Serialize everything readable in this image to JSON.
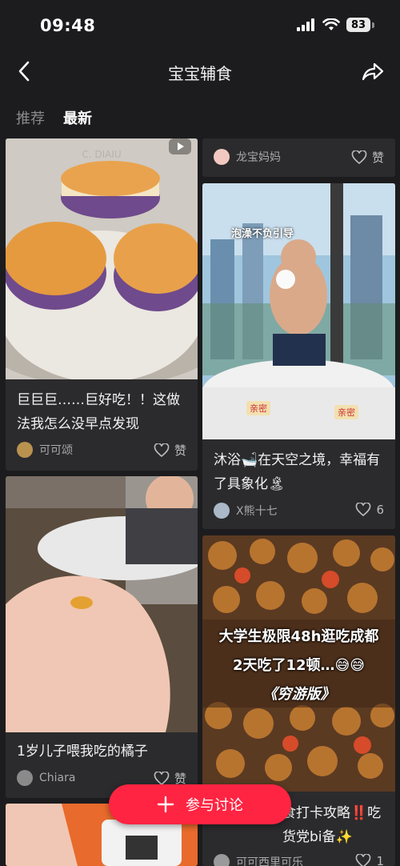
{
  "status_bar": {
    "time": "09:48",
    "battery": "83"
  },
  "nav": {
    "title": "宝宝辅食"
  },
  "tabs": [
    {
      "label": "推荐"
    },
    {
      "label": "最新"
    }
  ],
  "posts": [
    {
      "title": "巨巨巨……巨好吃！！这做法我怎么没早点发现",
      "author": "可可颂",
      "likes": "赞"
    },
    {
      "title": "1岁儿子喂我吃的橘子",
      "author": "Chiara",
      "likes": "赞"
    },
    {
      "title": "",
      "author": "龙宝妈妈",
      "likes": "赞"
    },
    {
      "title": "沐浴🛁在天空之境，幸福有了具象化🏝",
      "author": "X熊十七",
      "likes": "6",
      "overlay_text": [
        "泡澡不负引导",
        "亲密",
        "亲密"
      ]
    },
    {
      "title": "食打卡攻略‼️吃货党bi备✨",
      "author": "可可西里可乐",
      "likes": "1",
      "overlay_text": [
        "大学生极限48h逛吃成都",
        "2天吃了12顿…😅😅",
        "《穷游版》"
      ]
    }
  ],
  "cta": {
    "label": "参与讨论"
  },
  "colors": {
    "accent": "#ff2442",
    "background": "#1c1c1e",
    "card": "#2b2b2d"
  }
}
